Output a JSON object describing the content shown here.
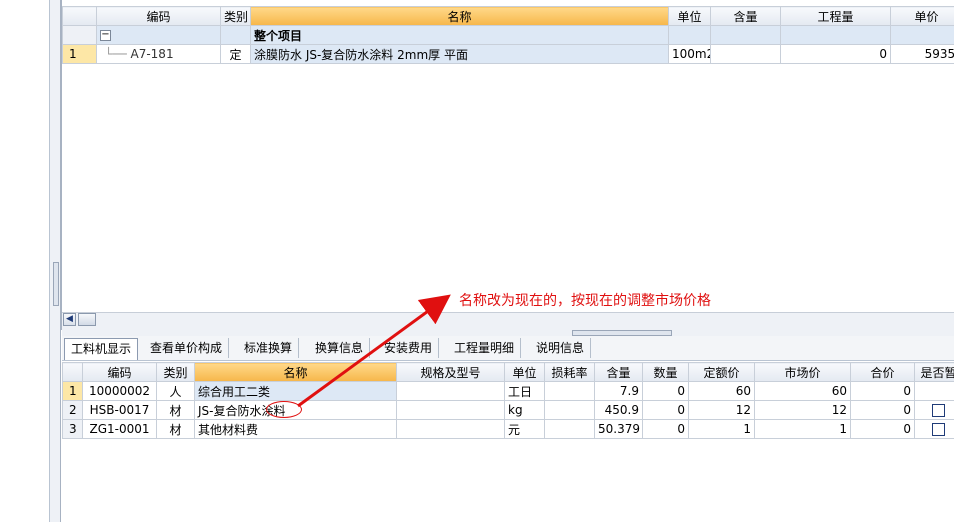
{
  "upper_grid": {
    "headers": [
      "",
      "编码",
      "类别",
      "名称",
      "单位",
      "含量",
      "工程量",
      "单价"
    ],
    "group_row": {
      "toggle": "−",
      "label": "整个项目"
    },
    "rows": [
      {
        "rn": "1",
        "code": "A7-181",
        "type": "定",
        "name": "涂膜防水 JS-复合防水涂料 2mm厚 平面",
        "unit": "100m2",
        "qty_content": "",
        "quantity": "0",
        "price": "5935."
      }
    ]
  },
  "tabs": [
    "工料机显示",
    "查看单价构成",
    "标准换算",
    "换算信息",
    "安装费用",
    "工程量明细",
    "说明信息"
  ],
  "lower_grid": {
    "headers": [
      "",
      "编码",
      "类别",
      "名称",
      "规格及型号",
      "单位",
      "损耗率",
      "含量",
      "数量",
      "定额价",
      "市场价",
      "合价",
      "是否暂"
    ],
    "rows": [
      {
        "rn": "1",
        "code": "10000002",
        "type": "人",
        "name": "综合用工二类",
        "spec": "",
        "unit": "工日",
        "loss": "",
        "content": "7.9",
        "count": "0",
        "base_price": "60",
        "market_price": "60",
        "total": "0",
        "provisional": ""
      },
      {
        "rn": "2",
        "code": "HSB-0017",
        "type": "材",
        "name": "JS-复合防水涂料",
        "spec": "",
        "unit": "kg",
        "loss": "",
        "content": "450.9",
        "count": "0",
        "base_price": "12",
        "market_price": "12",
        "total": "0",
        "provisional": "checkbox"
      },
      {
        "rn": "3",
        "code": "ZG1-0001",
        "type": "材",
        "name": "其他材料费",
        "spec": "",
        "unit": "元",
        "loss": "",
        "content": "50.379",
        "count": "0",
        "base_price": "1",
        "market_price": "1",
        "total": "0",
        "provisional": "checkbox"
      }
    ]
  },
  "annotation": {
    "text": "名称改为现在的，按现在的调整市场价格",
    "color": "#e01010"
  },
  "colors": {
    "header_selected": "#f6b64a",
    "row_highlight": "#dde8f5",
    "annotation": "#e01010"
  }
}
